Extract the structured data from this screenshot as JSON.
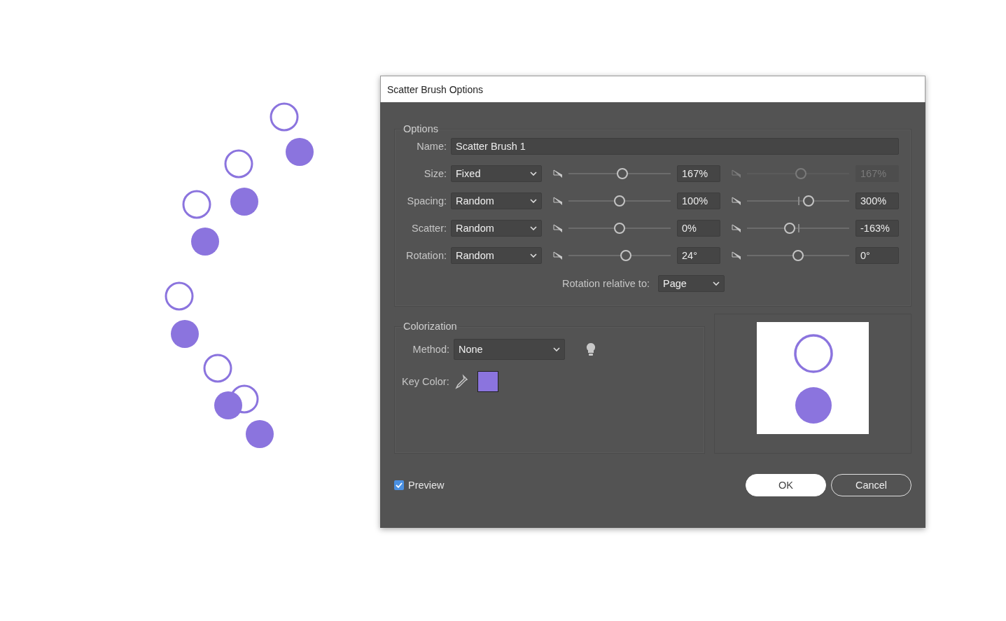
{
  "window": {
    "title": "Scatter Brush Options"
  },
  "options": {
    "title": "Options",
    "name_label": "Name:",
    "name_value": "Scatter Brush 1",
    "rows": [
      {
        "label": "Size:",
        "mode": "Fixed",
        "min": {
          "level": 0.53,
          "value": "167%"
        },
        "max": {
          "level": 0.53,
          "value": "167%",
          "disabled": true,
          "midpoint_mark": false
        }
      },
      {
        "label": "Spacing:",
        "mode": "Random",
        "min": {
          "level": 0.5,
          "value": "100%"
        },
        "max": {
          "level": 0.6,
          "value": "300%",
          "disabled": false,
          "midpoint_mark": true
        }
      },
      {
        "label": "Scatter:",
        "mode": "Random",
        "min": {
          "level": 0.5,
          "value": "0%"
        },
        "max": {
          "level": 0.42,
          "value": "-163%",
          "disabled": false,
          "midpoint_mark": true
        }
      },
      {
        "label": "Rotation:",
        "mode": "Random",
        "min": {
          "level": 0.56,
          "value": "24°"
        },
        "max": {
          "level": 0.5,
          "value": "0°",
          "disabled": false,
          "midpoint_mark": false
        }
      }
    ],
    "rotation_relative_label": "Rotation relative to:",
    "rotation_relative_value": "Page"
  },
  "colorization": {
    "title": "Colorization",
    "method_label": "Method:",
    "method_value": "None",
    "key_color_label": "Key Color:"
  },
  "preview": {
    "label": "Preview",
    "checked": true
  },
  "buttons": [
    {
      "label": "OK",
      "kind": "primary"
    },
    {
      "label": "Cancel",
      "kind": "secondary"
    }
  ]
}
